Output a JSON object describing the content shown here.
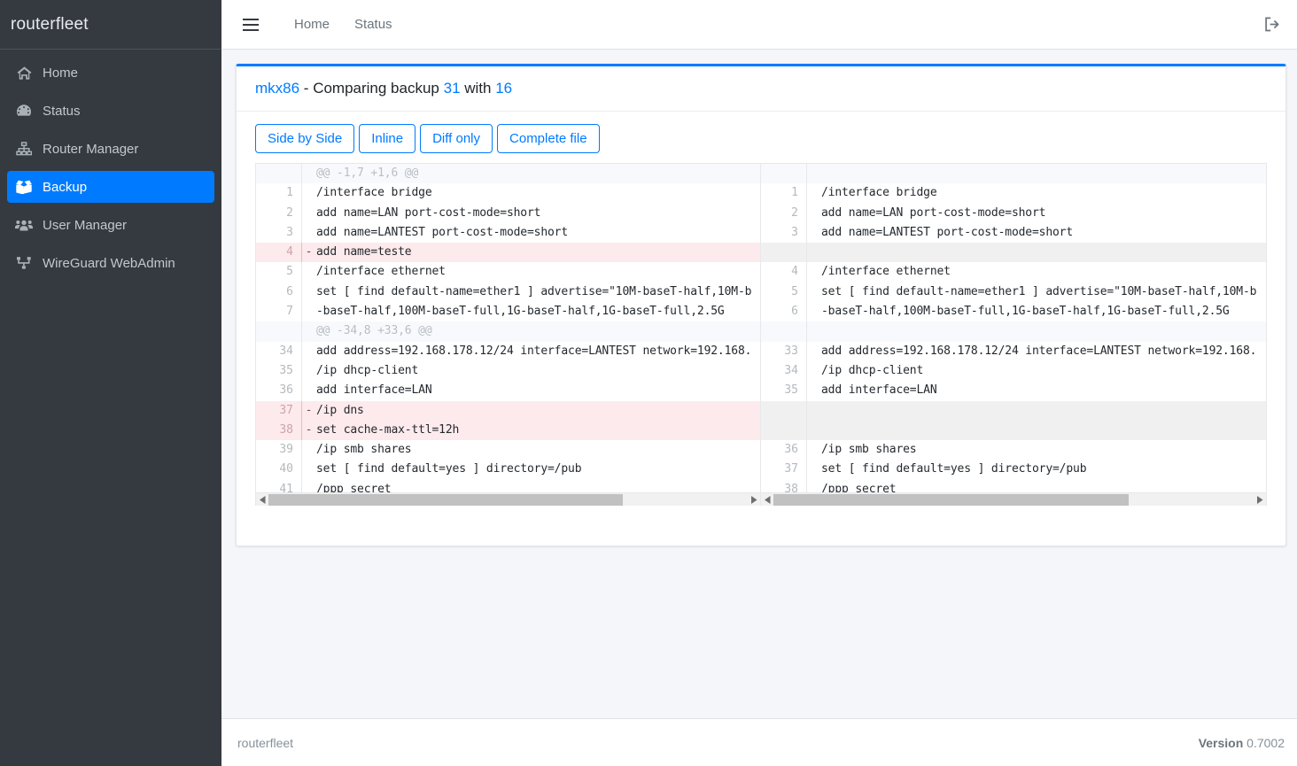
{
  "sidebar": {
    "brand": "routerfleet",
    "items": [
      {
        "label": "Home",
        "icon": "home-icon",
        "active": false
      },
      {
        "label": "Status",
        "icon": "gauge-icon",
        "active": false
      },
      {
        "label": "Router Manager",
        "icon": "sitemap-icon",
        "active": false
      },
      {
        "label": "Backup",
        "icon": "box-open-icon",
        "active": true
      },
      {
        "label": "User Manager",
        "icon": "users-icon",
        "active": false
      },
      {
        "label": "WireGuard WebAdmin",
        "icon": "network-wired-icon",
        "active": false
      }
    ]
  },
  "topbar": {
    "menu_icon": "hamburger-icon",
    "links": [
      {
        "label": "Home"
      },
      {
        "label": "Status"
      }
    ],
    "logout_icon": "sign-out-icon"
  },
  "card": {
    "title": {
      "router": "mkx86",
      "separator": " - ",
      "text_before": "Comparing backup ",
      "backup_a": "31",
      "text_middle": " with ",
      "backup_b": "16"
    },
    "buttons": [
      {
        "label": "Side by Side"
      },
      {
        "label": "Inline"
      },
      {
        "label": "Diff only"
      },
      {
        "label": "Complete file"
      }
    ]
  },
  "diff": {
    "left": [
      {
        "type": "hunk",
        "num": "",
        "marker": "",
        "code": "@@ -1,7 +1,6 @@"
      },
      {
        "type": "ctx",
        "num": "1",
        "marker": "",
        "code": "/interface bridge"
      },
      {
        "type": "ctx",
        "num": "2",
        "marker": "",
        "code": "add name=LAN port-cost-mode=short"
      },
      {
        "type": "ctx",
        "num": "3",
        "marker": "",
        "code": "add name=LANTEST port-cost-mode=short"
      },
      {
        "type": "del",
        "num": "4",
        "marker": "-",
        "code": "add name=teste"
      },
      {
        "type": "ctx",
        "num": "5",
        "marker": "",
        "code": "/interface ethernet"
      },
      {
        "type": "ctx",
        "num": "6",
        "marker": "",
        "code": "set [ find default-name=ether1 ] advertise=\"10M-baseT-half,10M-b"
      },
      {
        "type": "ctx",
        "num": "7",
        "marker": "",
        "code": "    -baseT-half,100M-baseT-full,1G-baseT-half,1G-baseT-full,2.5G"
      },
      {
        "type": "hunk",
        "num": "",
        "marker": "",
        "code": "@@ -34,8 +33,6 @@"
      },
      {
        "type": "ctx",
        "num": "34",
        "marker": "",
        "code": "add address=192.168.178.12/24 interface=LANTEST network=192.168."
      },
      {
        "type": "ctx",
        "num": "35",
        "marker": "",
        "code": "/ip dhcp-client"
      },
      {
        "type": "ctx",
        "num": "36",
        "marker": "",
        "code": "add interface=LAN"
      },
      {
        "type": "del",
        "num": "37",
        "marker": "-",
        "code": "/ip dns"
      },
      {
        "type": "del",
        "num": "38",
        "marker": "-",
        "code": "set cache-max-ttl=12h"
      },
      {
        "type": "ctx",
        "num": "39",
        "marker": "",
        "code": "/ip smb shares"
      },
      {
        "type": "ctx",
        "num": "40",
        "marker": "",
        "code": "set [ find default=yes ] directory=/pub"
      },
      {
        "type": "ctx",
        "num": "41",
        "marker": "",
        "code": "/ppp secret"
      }
    ],
    "right": [
      {
        "type": "blank",
        "num": "",
        "marker": "",
        "code": ""
      },
      {
        "type": "ctx",
        "num": "1",
        "marker": "",
        "code": "/interface bridge"
      },
      {
        "type": "ctx",
        "num": "2",
        "marker": "",
        "code": "add name=LAN port-cost-mode=short"
      },
      {
        "type": "ctx",
        "num": "3",
        "marker": "",
        "code": "add name=LANTEST port-cost-mode=short"
      },
      {
        "type": "empty",
        "num": "",
        "marker": "",
        "code": ""
      },
      {
        "type": "ctx",
        "num": "4",
        "marker": "",
        "code": "/interface ethernet"
      },
      {
        "type": "ctx",
        "num": "5",
        "marker": "",
        "code": "set [ find default-name=ether1 ] advertise=\"10M-baseT-half,10M-b"
      },
      {
        "type": "ctx",
        "num": "6",
        "marker": "",
        "code": "    -baseT-half,100M-baseT-full,1G-baseT-half,1G-baseT-full,2.5G"
      },
      {
        "type": "blank",
        "num": "",
        "marker": "",
        "code": ""
      },
      {
        "type": "ctx",
        "num": "33",
        "marker": "",
        "code": "add address=192.168.178.12/24 interface=LANTEST network=192.168."
      },
      {
        "type": "ctx",
        "num": "34",
        "marker": "",
        "code": "/ip dhcp-client"
      },
      {
        "type": "ctx",
        "num": "35",
        "marker": "",
        "code": "add interface=LAN"
      },
      {
        "type": "empty",
        "num": "",
        "marker": "",
        "code": ""
      },
      {
        "type": "empty",
        "num": "",
        "marker": "",
        "code": ""
      },
      {
        "type": "ctx",
        "num": "36",
        "marker": "",
        "code": "/ip smb shares"
      },
      {
        "type": "ctx",
        "num": "37",
        "marker": "",
        "code": "set [ find default=yes ] directory=/pub"
      },
      {
        "type": "ctx",
        "num": "38",
        "marker": "",
        "code": "/ppp secret"
      }
    ]
  },
  "footer": {
    "brand": "routerfleet",
    "version_label": "Version",
    "version_value": "0.7002"
  },
  "colors": {
    "accent": "#007bff",
    "sidebar_bg": "#343a40",
    "deleted_row": "#fdeaec",
    "empty_row": "#f0f0f0",
    "hunk_row": "#f8f9fc",
    "page_bg": "#f4f6f9"
  }
}
